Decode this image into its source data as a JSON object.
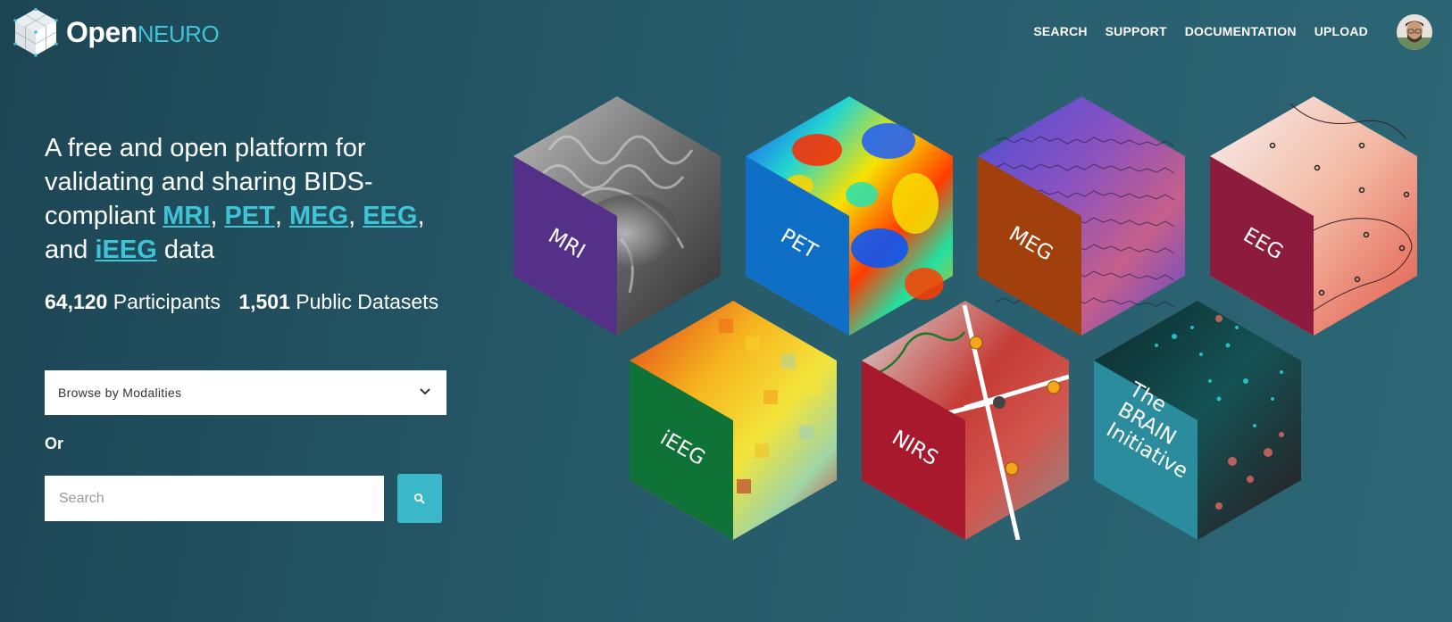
{
  "brand": {
    "open": "Open",
    "neuro": "NEURO"
  },
  "nav": {
    "search": "SEARCH",
    "support": "SUPPORT",
    "documentation": "DOCUMENTATION",
    "upload": "UPLOAD"
  },
  "hero": {
    "text_1": "A free and open platform for validating and sharing BIDS-compliant ",
    "mri": "MRI",
    "sep_1": ", ",
    "pet": "PET",
    "sep_2": ", ",
    "meg": "MEG",
    "sep_3": ", ",
    "eeg": "EEG",
    "sep_4": ", and ",
    "ieeg": "iEEG",
    "text_end": " data"
  },
  "stats": {
    "participants_count": "64,120",
    "participants_label": "Participants",
    "datasets_count": "1,501",
    "datasets_label": "Public Datasets"
  },
  "browse": {
    "label": "Browse by Modalities"
  },
  "or_label": "Or",
  "search": {
    "placeholder": "Search"
  },
  "modalities": {
    "mri": "MRI",
    "pet": "PET",
    "meg": "MEG",
    "eeg": "EEG",
    "ieeg": "iEEG",
    "nirs": "NIRS",
    "brain_1": "The",
    "brain_2": "BRAIN",
    "brain_3": "Initiative"
  },
  "colors": {
    "accent": "#3fc3d6",
    "mri": "#553089",
    "pet": "#0f6fc6",
    "meg": "#a1400c",
    "eeg": "#8d1b3d",
    "ieeg": "#0f7237",
    "nirs": "#a8192e",
    "brain": "#2a8c9c"
  }
}
